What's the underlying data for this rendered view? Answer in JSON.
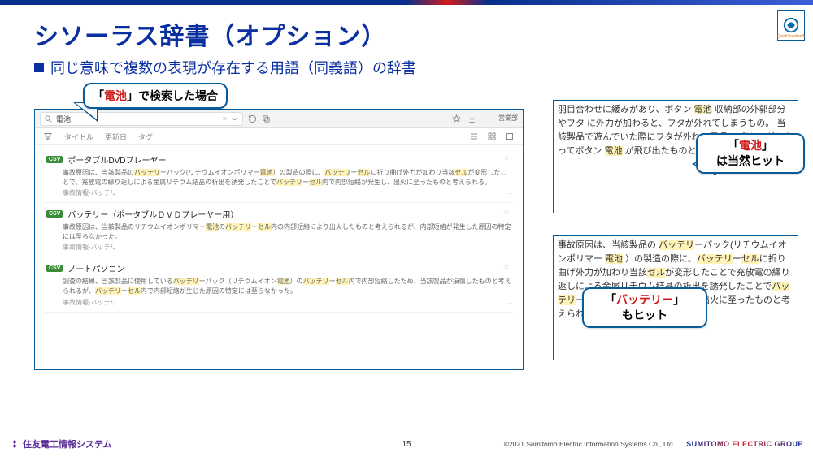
{
  "header": {
    "title": "シソーラス辞書（オプション）",
    "subtitle": "同じ意味で複数の表現が存在する用語（同義語）の辞書"
  },
  "callouts": {
    "c1_pre": "「",
    "c1_term": "電池",
    "c1_post": "」で検索した場合",
    "c2_pre": "「",
    "c2_term": "電池",
    "c2_post": "」",
    "c2_line2": "は当然ヒット",
    "c3_pre": "「",
    "c3_term": "バッテリー",
    "c3_post": "」",
    "c3_line2": "もヒット"
  },
  "search": {
    "query": "電池",
    "close_label": "×",
    "dept_label": "営業部",
    "filters": {
      "title": "タイトル",
      "date": "更新日",
      "tag": "タグ"
    },
    "results": [
      {
        "badge": "CSV",
        "title": "ポータブルDVDプレーヤー",
        "snippet_parts": [
          {
            "t": "事故原因は、当該製品の",
            "k": false
          },
          {
            "t": "バッテリ",
            "k": true
          },
          {
            "t": "ーパック(リチウムイオンポリマー",
            "k": false
          },
          {
            "t": "電池",
            "k": true
          },
          {
            "t": "）の製造の際に、",
            "k": false
          },
          {
            "t": "バッテリ",
            "k": true
          },
          {
            "t": "ー",
            "k": false
          },
          {
            "t": "セル",
            "k": true
          },
          {
            "t": "に折り曲げ外力が加わり当該",
            "k": false
          },
          {
            "t": "セル",
            "k": true
          },
          {
            "t": "が変形したことで、充放電の繰り返しによる金属リチウム結晶の析出を誘発したことで",
            "k": false
          },
          {
            "t": "バッテリ",
            "k": true
          },
          {
            "t": "ー",
            "k": false
          },
          {
            "t": "セル",
            "k": true
          },
          {
            "t": "内で内部短絡が発生し、出火に至ったものと考えられる。",
            "k": false
          }
        ],
        "meta": "事故情報-バッテリ"
      },
      {
        "badge": "CSV",
        "title": "バッテリー（ポータブルＤＶＤプレーヤー用）",
        "snippet_parts": [
          {
            "t": "事故原因は、当該製品のリチウムイオンポリマー",
            "k": false
          },
          {
            "t": "電池",
            "k": true
          },
          {
            "t": "の",
            "k": false
          },
          {
            "t": "バッテリ",
            "k": true
          },
          {
            "t": "ー",
            "k": false
          },
          {
            "t": "セル",
            "k": true
          },
          {
            "t": "内の内部短絡により出火したものと考えられるが、内部短絡が発生した原因の特定には至らなかった。",
            "k": false
          }
        ],
        "meta": "事故情報-バッテリ"
      },
      {
        "badge": "CSV",
        "title": "ノートパソコン",
        "snippet_parts": [
          {
            "t": "調査の結果、当該製品に使用している",
            "k": false
          },
          {
            "t": "バッテリ",
            "k": true
          },
          {
            "t": "ーパック（リチウムイオン",
            "k": false
          },
          {
            "t": "電池",
            "k": true
          },
          {
            "t": "）の",
            "k": false
          },
          {
            "t": "バッテリ",
            "k": true
          },
          {
            "t": "ー",
            "k": false
          },
          {
            "t": "セル",
            "k": true
          },
          {
            "t": "内で内部短絡したため、当該製品が損傷したものと考えられるが、",
            "k": false
          },
          {
            "t": "バッテリ",
            "k": true
          },
          {
            "t": "ー",
            "k": false
          },
          {
            "t": "セル",
            "k": true
          },
          {
            "t": "内で内部短絡が生じた原因の特定には至らなかった。",
            "k": false
          }
        ],
        "meta": "事故情報-バッテリ"
      }
    ]
  },
  "details": {
    "d1_parts": [
      {
        "t": "羽目合わせに緩みがあり、ボタン ",
        "k": false
      },
      {
        "t": "電池",
        "k": true
      },
      {
        "t": " 収納部の外郭部分やフタ\nに外力が加わると、フタが外れてしまうもの。\n当該製品で遊んでいた際にフタが外れ、電極スプリ\nングによってボタン ",
        "k": false
      },
      {
        "t": "電池",
        "k": true
      },
      {
        "t": " が飛び出たものと考えられ",
        "k": false
      }
    ],
    "d2_parts": [
      {
        "t": "事故原因は、当該製品の ",
        "k": false
      },
      {
        "t": "バッテリ",
        "k": true
      },
      {
        "t": "ーパック(リチウムイオンポリマー ",
        "k": false
      },
      {
        "t": "電池",
        "k": true
      },
      {
        "t": " ）の製造の際に、",
        "k": false
      },
      {
        "t": "バッテリ",
        "k": true
      },
      {
        "t": "ー",
        "k": false
      },
      {
        "t": "セル",
        "k": true
      },
      {
        "t": "に折り曲げ外力が加わり当該",
        "k": false
      },
      {
        "t": "セル",
        "k": true
      },
      {
        "t": "が変形したことで充放電の繰り返しによる金属リチウム結晶の析出を誘発したことで",
        "k": false
      },
      {
        "t": "バッテリ",
        "k": true
      },
      {
        "t": "ー",
        "k": false
      },
      {
        "t": "セル",
        "k": true
      },
      {
        "t": "内で内部短絡が発生し、出火に至ったものと考えられ",
        "k": false
      }
    ]
  },
  "footer": {
    "company": "住友電工情報システム",
    "page": "15",
    "copyright": "©2021 Sumitomo Electric Information Systems Co., Ltd.",
    "group": "SUMITOMO ELECTRIC GROUP"
  }
}
